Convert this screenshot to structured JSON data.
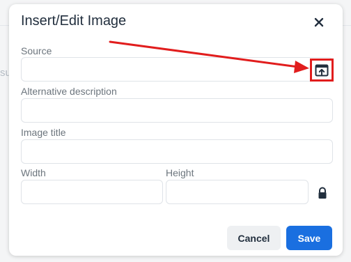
{
  "backdrop": {
    "partial_text": "su"
  },
  "dialog": {
    "title": "Insert/Edit Image",
    "close_symbol": "✕",
    "source": {
      "label": "Source",
      "value": ""
    },
    "alt": {
      "label": "Alternative description",
      "value": ""
    },
    "image_title": {
      "label": "Image title",
      "value": ""
    },
    "width": {
      "label": "Width",
      "value": ""
    },
    "height": {
      "label": "Height",
      "value": ""
    },
    "buttons": {
      "cancel": "Cancel",
      "save": "Save"
    },
    "icons": {
      "browse": "upload-browse-icon",
      "lock": "lock-icon",
      "close": "close-icon"
    }
  },
  "annotation": {
    "color": "#e11d1d"
  },
  "colors": {
    "accent": "#1a6fe0",
    "annotation": "#e11d1d"
  }
}
